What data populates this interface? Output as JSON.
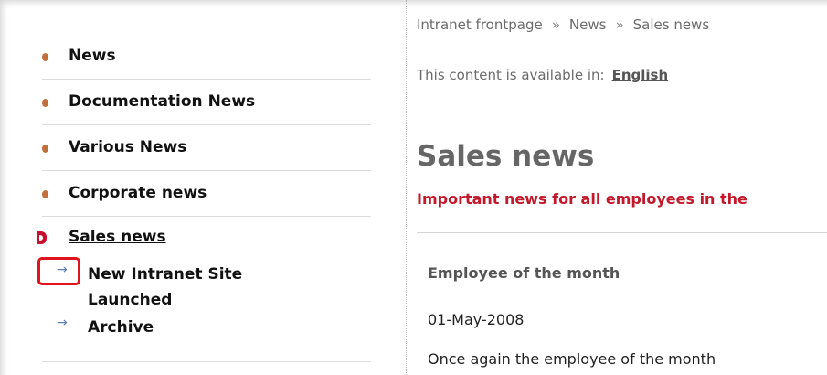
{
  "nav": {
    "items": [
      {
        "label": "News"
      },
      {
        "label": "Documentation News"
      },
      {
        "label": "Various News"
      },
      {
        "label": "Corporate news"
      }
    ],
    "current": {
      "label": "Sales news"
    },
    "subitems": [
      {
        "label": "New Intranet Site Launched"
      },
      {
        "label": "Archive"
      }
    ]
  },
  "breadcrumb": [
    "Intranet frontpage",
    "News",
    "Sales news"
  ],
  "breadcrumb_separator": "»",
  "language": {
    "prefix": "This content is available in:",
    "link": "English"
  },
  "page": {
    "title": "Sales news",
    "intro": "Important news for all employees in the"
  },
  "article": {
    "title": "Employee of the month",
    "date": "01-May-2008",
    "body": "Once again the employee of the month"
  },
  "colors": {
    "accent_red": "#c21a2c",
    "bullet": "#c0703a",
    "highlight": "#e0141e"
  }
}
